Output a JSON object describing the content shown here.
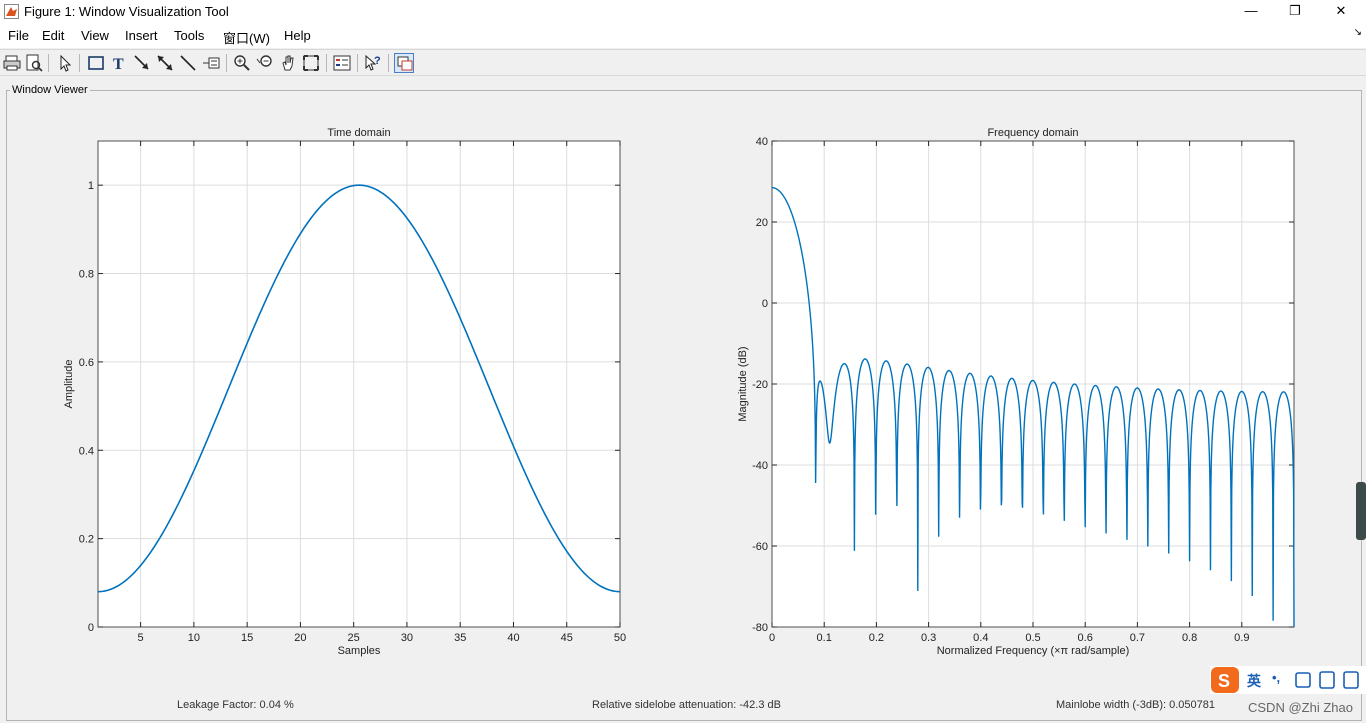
{
  "window": {
    "title": "Figure 1: Window Visualization Tool",
    "minimize_glyph": "—",
    "maximize_glyph": "❐",
    "close_glyph": "✕"
  },
  "menu": [
    {
      "label": "File"
    },
    {
      "label": "Edit"
    },
    {
      "label": "View"
    },
    {
      "label": "Insert"
    },
    {
      "label": "Tools"
    },
    {
      "label": "窗口(W)"
    },
    {
      "label": "Help"
    }
  ],
  "menu_dock_glyph": "↘",
  "toolbar": {
    "icons": [
      "print-icon",
      "print-preview-icon",
      "select-arrow-icon",
      "insert-rectangle-icon",
      "insert-text-icon",
      "insert-arrow-icon",
      "insert-double-arrow-icon",
      "insert-line-icon",
      "insert-legend-icon",
      "zoom-in-icon",
      "zoom-out-icon",
      "pan-icon",
      "fit-view-icon",
      "legend-toggle-icon",
      "whats-this-icon",
      "dock-window-icon"
    ]
  },
  "panel": {
    "title": "Window Viewer"
  },
  "status": {
    "leakage": "Leakage Factor: 0.04 %",
    "sidelobe": "Relative sidelobe attenuation: -42.3 dB",
    "mainlobe": "Mainlobe width (-3dB): 0.050781"
  },
  "ime": {
    "label": "英",
    "punct": "•,"
  },
  "watermark": "CSDN @Zhi Zhao",
  "colors": {
    "line": "#0072bd",
    "grid": "#dddddd",
    "axes_bg": "#ffffff"
  },
  "chart_data": [
    {
      "type": "line",
      "title": "Time domain",
      "xlabel": "Samples",
      "ylabel": "Amplitude",
      "xlim": [
        1,
        50
      ],
      "ylim": [
        0,
        1.1
      ],
      "xticks": [
        5,
        10,
        15,
        20,
        25,
        30,
        35,
        40,
        45,
        50
      ],
      "yticks": [
        0,
        0.2,
        0.4,
        0.6,
        0.8,
        1
      ],
      "ytick_labels": [
        "0",
        "0.2",
        "0.4",
        "0.6",
        "0.8",
        "1"
      ],
      "grid": true,
      "window": "hamming",
      "n": 50
    },
    {
      "type": "line",
      "title": "Frequency domain",
      "xlabel": "Normalized Frequency  (×π rad/sample)",
      "ylabel": "Magnitude (dB)",
      "xlim": [
        0,
        1
      ],
      "ylim": [
        -80,
        40
      ],
      "xticks": [
        0,
        0.1,
        0.2,
        0.3,
        0.4,
        0.5,
        0.6,
        0.7,
        0.8,
        0.9
      ],
      "yticks": [
        -80,
        -60,
        -40,
        -20,
        0,
        20,
        40
      ],
      "grid": true,
      "peak_db": 28.8,
      "first_null": 0.08
    }
  ]
}
